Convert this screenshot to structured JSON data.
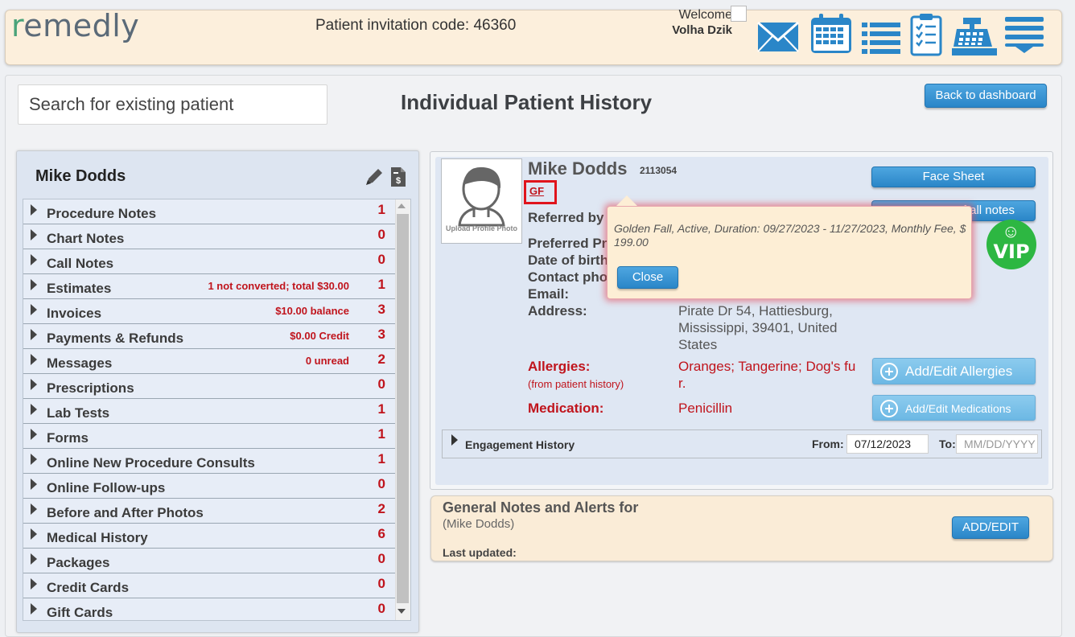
{
  "header": {
    "logo_text": "emedly",
    "logo_letter": "r",
    "invitation": "Patient invitation code: 46360",
    "welcome": "Welcome",
    "user_name": "Volha Dzik",
    "icons": [
      "mail-icon",
      "calendar-icon",
      "list-icon",
      "checklist-icon",
      "cash-register-icon",
      "menu-icon"
    ]
  },
  "search": {
    "placeholder": "Search for existing patient"
  },
  "page_title": "Individual Patient History",
  "back_button": "Back to dashboard",
  "left_panel": {
    "patient_name": "Mike Dodds",
    "items": [
      {
        "label": "Procedure Notes",
        "note": "",
        "count": "1"
      },
      {
        "label": "Chart Notes",
        "note": "",
        "count": "0"
      },
      {
        "label": "Call Notes",
        "note": "",
        "count": "0"
      },
      {
        "label": "Estimates",
        "note": "1 not converted; total $30.00",
        "count": "1"
      },
      {
        "label": "Invoices",
        "note": "$10.00 balance",
        "count": "3"
      },
      {
        "label": "Payments & Refunds",
        "note": "$0.00 Credit",
        "count": "3"
      },
      {
        "label": "Messages",
        "note": "0 unread",
        "count": "2"
      },
      {
        "label": "Prescriptions",
        "note": "",
        "count": "0"
      },
      {
        "label": "Lab Tests",
        "note": "",
        "count": "1"
      },
      {
        "label": "Forms",
        "note": "",
        "count": "1"
      },
      {
        "label": "Online New Procedure Consults",
        "note": "",
        "count": "1"
      },
      {
        "label": "Online Follow-ups",
        "note": "",
        "count": "0"
      },
      {
        "label": "Before and After Photos",
        "note": "",
        "count": "2"
      },
      {
        "label": "Medical History",
        "note": "",
        "count": "6"
      },
      {
        "label": "Packages",
        "note": "",
        "count": "0"
      },
      {
        "label": "Credit Cards",
        "note": "",
        "count": "0"
      },
      {
        "label": "Gift Cards",
        "note": "",
        "count": "0"
      }
    ]
  },
  "patient": {
    "name": "Mike Dodds",
    "id": "2113054",
    "membership_code": "GF",
    "upload_photo": "Upload Profile Photo",
    "referred_label": "Referred by",
    "preferred_label": "Preferred Pr",
    "dob_label": "Date of birth",
    "contact_label": "Contact pho",
    "email_label": "Email:",
    "address_label": "Address:",
    "address_lines": [
      "Pirate Dr 54, Hattiesburg,",
      "Mississippi, 39401, United",
      "States"
    ],
    "allergies_label": "Allergies:",
    "allergies_sub": "(from patient history)",
    "allergies_lines": [
      "Oranges; Tangerine; Dog's fu",
      "r."
    ],
    "medication_label": "Medication:",
    "medication_value": "Penicillin",
    "vip_text": "VIP",
    "vip_smile": "☺"
  },
  "buttons": {
    "face_sheet": "Face Sheet",
    "all_notes": "of all notes",
    "add_allergies": "Add/Edit Allergies",
    "add_medications": "Add/Edit Medications"
  },
  "engagement": {
    "label": "Engagement History",
    "from_label": "From:",
    "from_value": "07/12/2023",
    "to_label": "To:",
    "to_placeholder": "MM/DD/YYYY"
  },
  "general_notes": {
    "title": "General Notes and Alerts for",
    "subtitle": "(Mike Dodds)",
    "last_updated": "Last updated:",
    "add_edit": "ADD/EDIT"
  },
  "popup": {
    "text": "Golden Fall, Active, Duration: 09/27/2023 - 11/27/2023, Monthly Fee, $ 199.00",
    "close": "Close"
  },
  "colors": {
    "accent_blue": "#2a86c8",
    "alert_red": "#c0141c",
    "vip_green": "#2db742",
    "header_bg": "#fcefdc"
  }
}
